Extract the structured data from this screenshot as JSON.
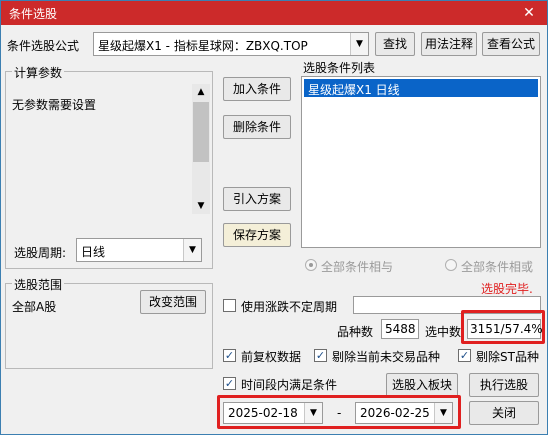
{
  "window": {
    "title": "条件选股",
    "close_symbol": "✕"
  },
  "formula": {
    "label": "条件选股公式",
    "value": "星级起爆X1  -  指标星球网：ZBXQ.TOP"
  },
  "buttons": {
    "find": "查找",
    "usage": "用法注释",
    "view_formula": "查看公式",
    "add_condition": "加入条件",
    "delete_condition": "删除条件",
    "import_plan": "引入方案",
    "save_plan": "保存方案",
    "change_range": "改变范围",
    "add_to_board": "选股入板块",
    "execute": "执行选股",
    "close": "关闭"
  },
  "calc_params": {
    "legend": "计算参数",
    "message": "无参数需要设置",
    "period_label": "选股周期:",
    "period_value": "日线"
  },
  "condition_list": {
    "label": "选股条件列表",
    "items": [
      "星级起爆X1  日线"
    ]
  },
  "logic": {
    "and_label": "全部条件相与",
    "or_label": "全部条件相或",
    "selected": "and"
  },
  "status_text": "选股完毕.",
  "status_color": "#e02020",
  "range": {
    "legend": "选股范围",
    "value": "全部A股"
  },
  "options": {
    "unfixed_period_label": "使用涨跌不定周期",
    "count_label": "品种数",
    "count_value": "5488",
    "selected_label": "选中数",
    "selected_value": "3151/57.4%",
    "pre_adjust_label": "前复权数据",
    "exclude_untraded_label": "剔除当前未交易品种",
    "exclude_st_label": "剔除ST品种",
    "time_range_label": "时间段内满足条件"
  },
  "dates": {
    "start": "2025-02-18",
    "separator": "-",
    "end": "2026-02-25"
  },
  "colors": {
    "title_bar": "#cc2a2a",
    "selection": "#0a64c8",
    "highlight": "#e02020"
  }
}
